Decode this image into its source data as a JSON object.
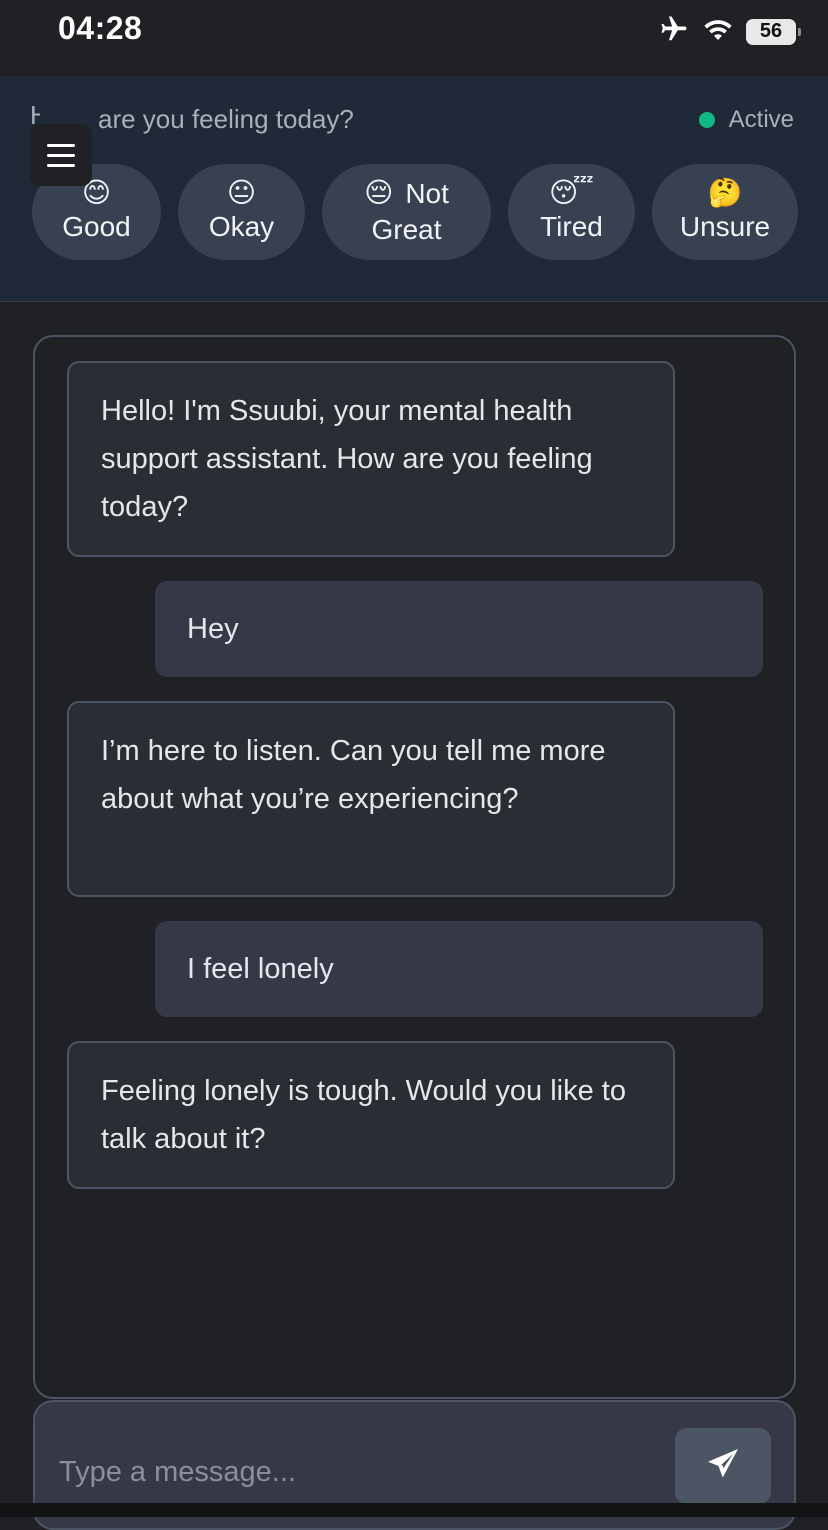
{
  "status_bar": {
    "time": "04:28",
    "battery_percent": "56",
    "icons": [
      "airplane-mode-icon",
      "wifi-icon",
      "battery-icon"
    ]
  },
  "header": {
    "question_prefix": "H",
    "question": "are you feeling today?",
    "status": "Active",
    "status_color": "#10b981",
    "menu_icon": "hamburger-menu-icon"
  },
  "moods": [
    {
      "emoji": "😊",
      "label": "Good"
    },
    {
      "emoji": "😐",
      "label": "Okay"
    },
    {
      "emoji": "😔",
      "label_top": "Not",
      "label": "Great"
    },
    {
      "emoji": "😴",
      "label": "Tired"
    },
    {
      "emoji": "🤔",
      "label": "Unsure"
    }
  ],
  "messages": [
    {
      "role": "bot",
      "text": "Hello! I'm Ssuubi, your mental health support assistant. How are you feeling today?"
    },
    {
      "role": "user",
      "text": "Hey"
    },
    {
      "role": "bot",
      "text": "I’m here to listen. Can you tell me more about what you’re experiencing?"
    },
    {
      "role": "user",
      "text": "I feel lonely"
    },
    {
      "role": "bot",
      "text": "Feeling lonely is tough. Would you like to talk about it?"
    }
  ],
  "composer": {
    "placeholder": "Type a message...",
    "value": "",
    "send_icon": "send-paper-plane-icon"
  },
  "colors": {
    "background": "#1f2124",
    "header": "#1f2937",
    "chip": "#374151",
    "bot_bubble": "#2a2d33",
    "user_bubble": "#363848"
  }
}
